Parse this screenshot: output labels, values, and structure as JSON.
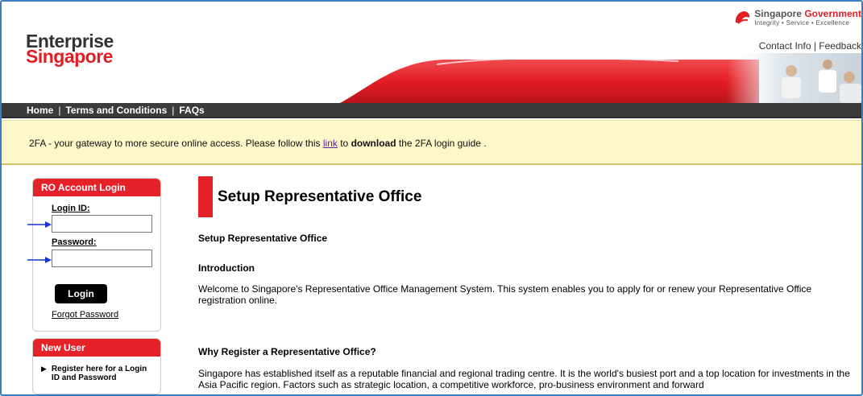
{
  "header": {
    "logo_line1": "Enterprise",
    "logo_line2": "Singapore",
    "gov_title_a": "Singapore",
    "gov_title_b": "Government",
    "gov_tagline": "Integrity • Service • Excellence",
    "contact_label": "Contact Info",
    "feedback_label": "Feedback"
  },
  "nav": {
    "items": [
      {
        "label": "Home"
      },
      {
        "label": "Terms and Conditions"
      },
      {
        "label": "FAQs"
      }
    ]
  },
  "notice": {
    "text_before": "2FA - your gateway to more secure online access. Please follow this ",
    "link_label": "link",
    "text_mid": " to ",
    "bold_word": "download",
    "text_after": " the 2FA login guide ."
  },
  "login_box": {
    "title": "RO Account Login",
    "login_id_label": "Login ID:",
    "login_id_value": "",
    "password_label": "Password:",
    "password_value": "",
    "login_button": "Login",
    "forgot_password": "Forgot Password"
  },
  "new_user_box": {
    "title": "New User",
    "register_link": "Register here for a Login ID and Password"
  },
  "content": {
    "page_title": "Setup Representative Office",
    "section_heading": "Setup Representative Office",
    "intro_heading": "Introduction",
    "intro_text": "Welcome to Singapore's Representative Office Management System.  This system enables you to apply for or renew your Representative Office registration online.",
    "why_heading": "Why Register a Representative Office?",
    "why_text": "Singapore has established itself as a reputable financial and regional trading centre. It is the world's busiest port and a top location for investments in the Asia Pacific region.  Factors such as strategic location, a competitive workforce, pro-business environment and forward"
  },
  "colors": {
    "brand_red": "#e52229",
    "nav_bg": "#3b3b3b",
    "notice_bg": "#fdf8c9",
    "arrow_blue": "#1a33d6"
  }
}
